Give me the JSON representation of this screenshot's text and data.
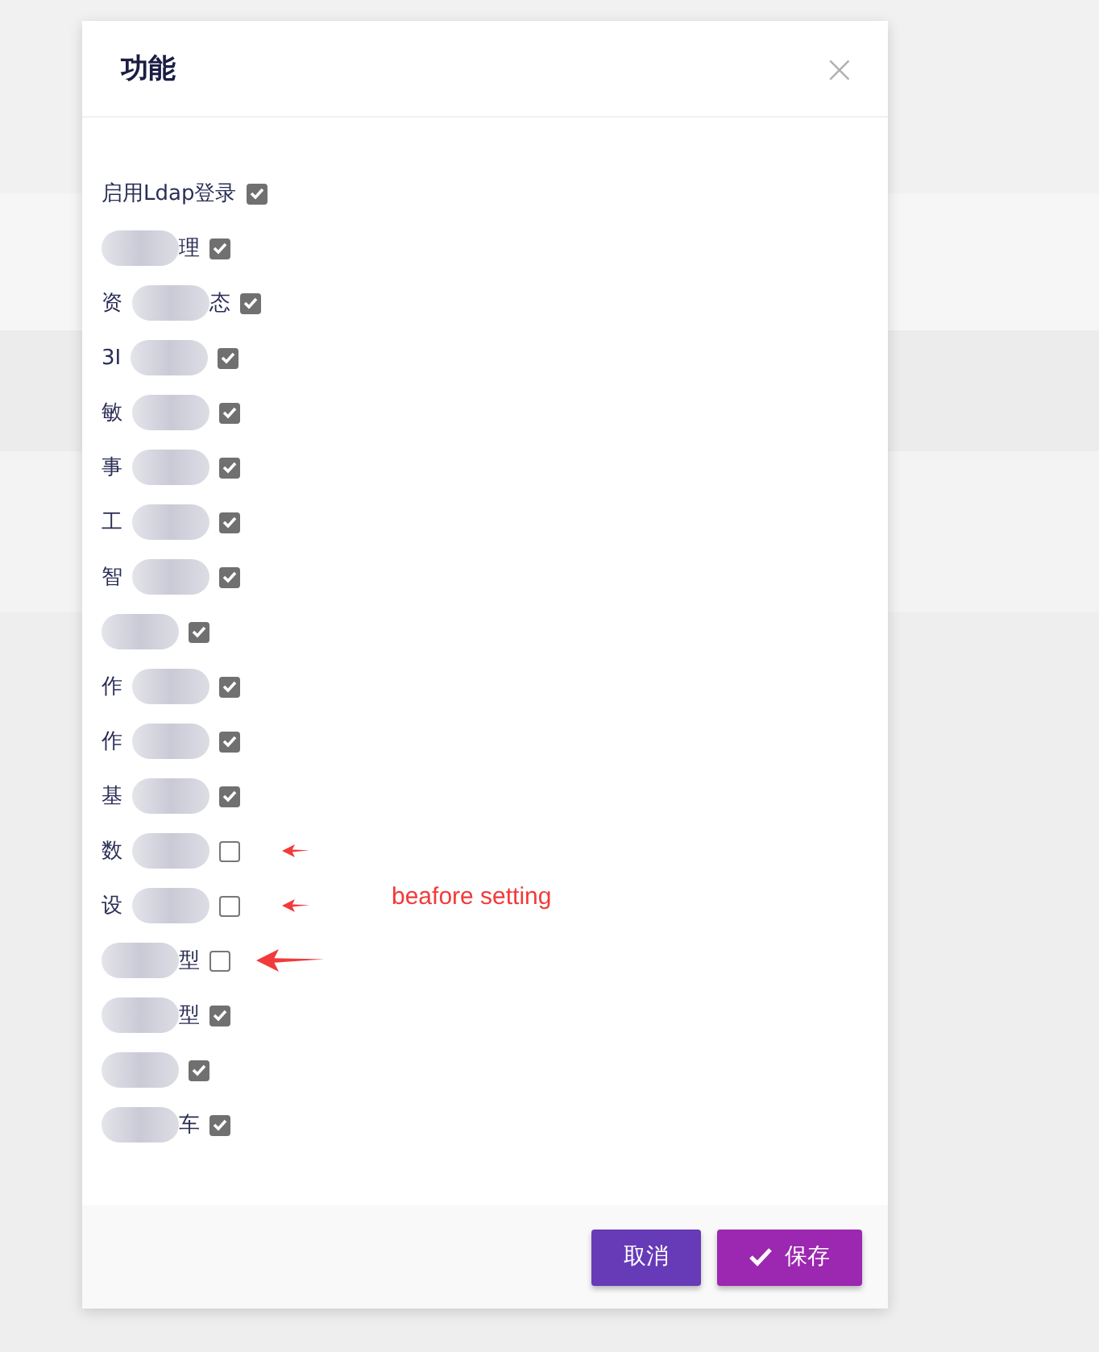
{
  "dialog": {
    "title": "功能",
    "close": "×"
  },
  "items": [
    {
      "kind": "plain",
      "label_start": "启用Ldap登录",
      "checked": true
    },
    {
      "kind": "redacted",
      "label_end": "理",
      "checked": true
    },
    {
      "kind": "redacted",
      "label_start": "资",
      "label_end": "态",
      "checked": true
    },
    {
      "kind": "redacted",
      "label_start": "3I",
      "checked": true
    },
    {
      "kind": "redacted",
      "label_start": "敏",
      "checked": true
    },
    {
      "kind": "redacted",
      "label_start": "事",
      "checked": true
    },
    {
      "kind": "redacted",
      "label_start": "工",
      "checked": true
    },
    {
      "kind": "redacted",
      "label_start": "智",
      "checked": true
    },
    {
      "kind": "redacted",
      "checked": true
    },
    {
      "kind": "redacted",
      "label_start": "作",
      "checked": true
    },
    {
      "kind": "redacted",
      "label_start": "作",
      "checked": true
    },
    {
      "kind": "redacted",
      "label_start": "基",
      "checked": true
    },
    {
      "kind": "redacted",
      "label_start": "数",
      "checked": false,
      "arrow": {
        "kind": "small"
      }
    },
    {
      "kind": "redacted",
      "label_start": "设",
      "checked": false,
      "arrow": {
        "kind": "small"
      }
    },
    {
      "kind": "redacted",
      "label_end": "型",
      "checked": false,
      "arrow": {
        "kind": "large"
      }
    },
    {
      "kind": "redacted",
      "label_end": "型",
      "checked": true
    },
    {
      "kind": "redacted",
      "checked": true
    },
    {
      "kind": "redacted",
      "label_end": "车",
      "checked": true
    }
  ],
  "annotation": "beafore setting",
  "buttons": [
    {
      "kind": "cancel",
      "label": "取消"
    },
    {
      "kind": "save",
      "label": "保存"
    }
  ]
}
